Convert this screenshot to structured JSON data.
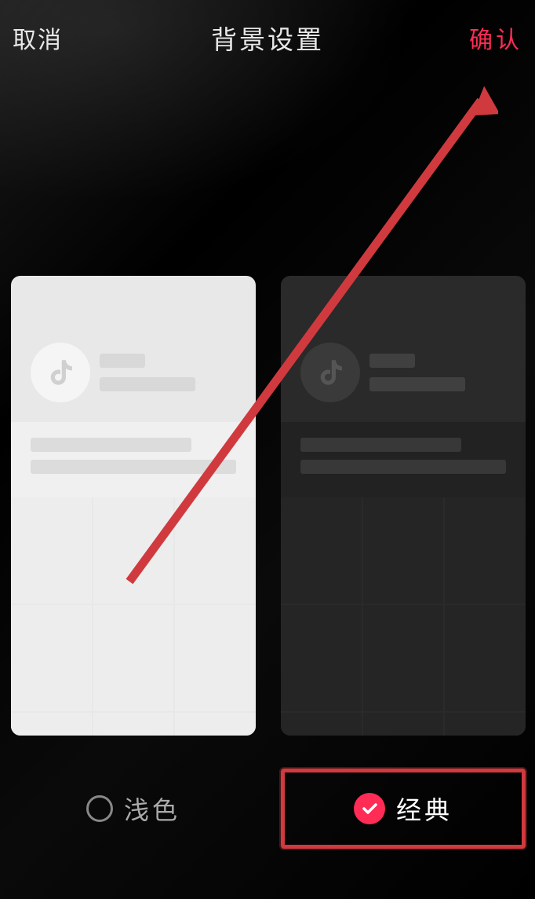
{
  "header": {
    "cancel": "取消",
    "title": "背景设置",
    "confirm": "确认"
  },
  "themes": {
    "light": {
      "label": "浅色",
      "selected": false
    },
    "dark": {
      "label": "经典",
      "selected": true
    }
  },
  "colors": {
    "accent": "#ff2c55",
    "highlight_border": "#d03a3f"
  }
}
